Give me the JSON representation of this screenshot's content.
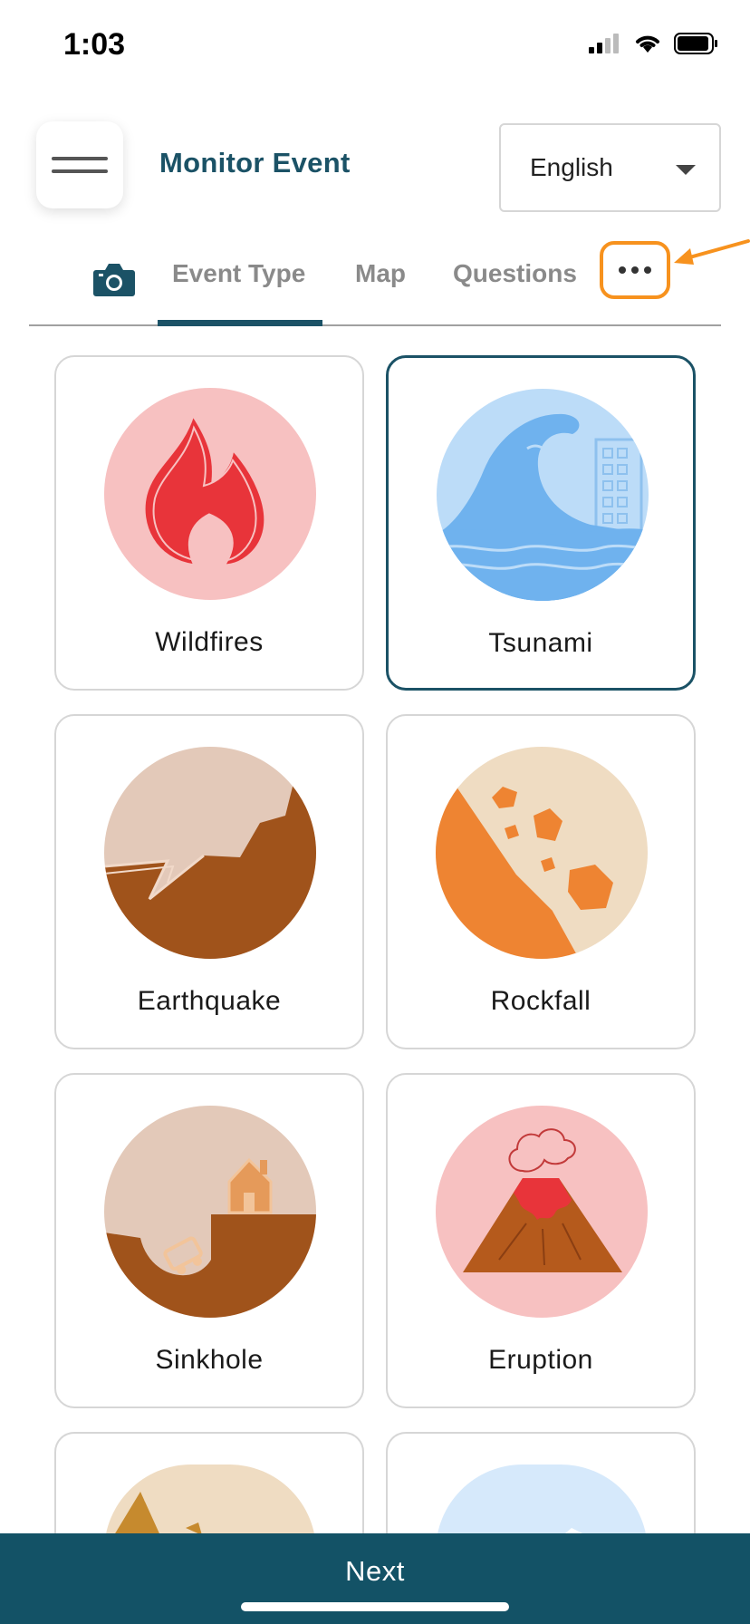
{
  "status_bar": {
    "time": "1:03"
  },
  "header": {
    "title": "Monitor Event",
    "language": "English"
  },
  "tabs": {
    "items": [
      {
        "label": "Event Type",
        "active": true
      },
      {
        "label": "Map",
        "active": false
      },
      {
        "label": "Questions",
        "active": false
      }
    ]
  },
  "events": [
    {
      "label": "Wildfires",
      "icon": "wildfire-icon",
      "selected": false
    },
    {
      "label": "Tsunami",
      "icon": "tsunami-icon",
      "selected": true
    },
    {
      "label": "Earthquake",
      "icon": "earthquake-icon",
      "selected": false
    },
    {
      "label": "Rockfall",
      "icon": "rockfall-icon",
      "selected": false
    },
    {
      "label": "Sinkhole",
      "icon": "sinkhole-icon",
      "selected": false
    },
    {
      "label": "Eruption",
      "icon": "eruption-icon",
      "selected": false
    }
  ],
  "footer": {
    "next_label": "Next"
  },
  "colors": {
    "brand": "#135266",
    "highlight": "#f7921e"
  }
}
